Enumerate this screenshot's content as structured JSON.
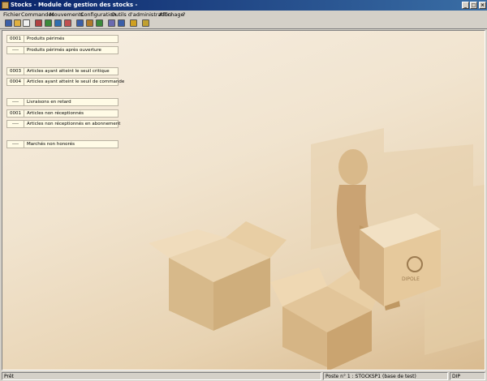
{
  "window": {
    "title": "Stocks - Module de gestion des stocks -"
  },
  "menu": [
    "Fichier",
    "Commandes",
    "Mouvements",
    "Configuration",
    "Outils d'administration",
    "Affichage",
    "?"
  ],
  "toolbar": {
    "buttons": [
      {
        "icon": "info-icon",
        "color": "#3b5fa8"
      },
      {
        "icon": "open-folder-icon",
        "color": "#e0b040"
      },
      {
        "icon": "document-icon",
        "color": "#f0f0f0"
      },
      {
        "icon": "list-icon",
        "color": "#b04040"
      },
      {
        "icon": "grid-icon",
        "color": "#3a8a3a"
      },
      {
        "icon": "calculator-icon",
        "color": "#2f6fb0"
      },
      {
        "icon": "chart-icon",
        "color": "#c05050"
      },
      {
        "icon": "window-icon",
        "color": "#3b5fa8"
      },
      {
        "icon": "book-icon",
        "color": "#b07a2a"
      },
      {
        "icon": "tag-icon",
        "color": "#3a8a3a"
      },
      {
        "icon": "report-icon",
        "color": "#6a6ab0"
      },
      {
        "icon": "table-icon",
        "color": "#3b5fa8"
      },
      {
        "icon": "bell-icon",
        "color": "#d0a020"
      },
      {
        "icon": "tools-icon",
        "color": "#c0a030"
      }
    ]
  },
  "panels": [
    {
      "num": "0001",
      "label": "Produits périmés"
    },
    {
      "num": "----",
      "label": "Produits périmés après ouverture"
    },
    {
      "num": "0003",
      "label": "Articles ayant atteint le seuil critique"
    },
    {
      "num": "0004",
      "label": "Articles ayant atteint le seuil de commande"
    },
    {
      "num": "----",
      "label": "Livraisons en retard"
    },
    {
      "num": "0001",
      "label": "Articles non réceptionnés"
    },
    {
      "num": "----",
      "label": "Articles non réceptionnés en abonnement"
    },
    {
      "num": "----",
      "label": "Marchés non honorés"
    }
  ],
  "logo": {
    "text": "DIPOLE"
  },
  "status": {
    "left": "Prêt",
    "station": "Poste n° 1 : STOCKSP1 (base de test)",
    "user": "DIP"
  },
  "colors": {
    "title_start": "#0a246a",
    "title_end": "#3a6ea5",
    "panel_bg": "#fffbe6"
  }
}
